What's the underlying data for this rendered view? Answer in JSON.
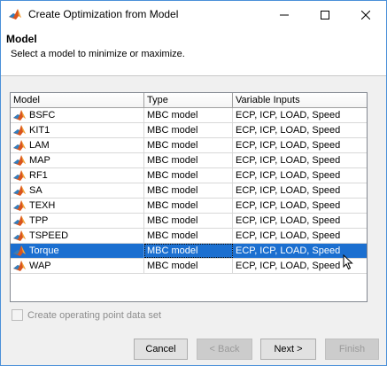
{
  "window": {
    "title": "Create Optimization from Model"
  },
  "header": {
    "section_title": "Model",
    "description": "Select a model to minimize or maximize."
  },
  "table": {
    "columns": [
      "Model",
      "Type",
      "Variable Inputs"
    ],
    "rows": [
      {
        "model": "BSFC",
        "type": "MBC model",
        "inputs": "ECP, ICP, LOAD, Speed"
      },
      {
        "model": "KIT1",
        "type": "MBC model",
        "inputs": "ECP, ICP, LOAD, Speed"
      },
      {
        "model": "LAM",
        "type": "MBC model",
        "inputs": "ECP, ICP, LOAD, Speed"
      },
      {
        "model": "MAP",
        "type": "MBC model",
        "inputs": "ECP, ICP, LOAD, Speed"
      },
      {
        "model": "RF1",
        "type": "MBC model",
        "inputs": "ECP, ICP, LOAD, Speed"
      },
      {
        "model": "SA",
        "type": "MBC model",
        "inputs": "ECP, ICP, LOAD, Speed"
      },
      {
        "model": "TEXH",
        "type": "MBC model",
        "inputs": "ECP, ICP, LOAD, Speed"
      },
      {
        "model": "TPP",
        "type": "MBC model",
        "inputs": "ECP, ICP, LOAD, Speed"
      },
      {
        "model": "TSPEED",
        "type": "MBC model",
        "inputs": "ECP, ICP, LOAD, Speed"
      },
      {
        "model": "Torque",
        "type": "MBC model",
        "inputs": "ECP, ICP, LOAD, Speed"
      },
      {
        "model": "WAP",
        "type": "MBC model",
        "inputs": "ECP, ICP, LOAD, Speed"
      }
    ],
    "selected_model": "Torque",
    "row_icon": "matlab-model-icon"
  },
  "options": {
    "operating_point_label": "Create operating point data set",
    "operating_point_checked": false,
    "operating_point_enabled": false
  },
  "buttons": {
    "cancel": "Cancel",
    "back": "< Back",
    "next": "Next >",
    "finish": "Finish"
  },
  "colors": {
    "selection": "#1b6fd0",
    "window_border": "#4a90d9"
  }
}
